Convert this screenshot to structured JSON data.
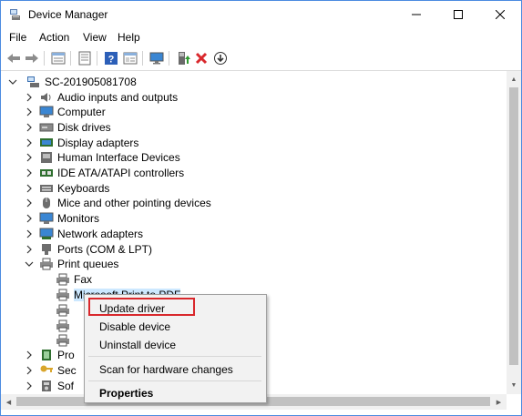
{
  "window": {
    "title": "Device Manager",
    "accent": "#4c8be0"
  },
  "menu": [
    "File",
    "Action",
    "View",
    "Help"
  ],
  "toolbar": {
    "icons": [
      "back-arrow-icon",
      "forward-arrow-icon",
      "properties-icon",
      "hide-show-tree-icon",
      "help-icon",
      "view-list-icon",
      "monitor-icon",
      "enable-device-icon",
      "uninstall-device-icon",
      "download-driver-icon"
    ],
    "accent_red": "#d9282c",
    "accent_green": "#2e9b2e"
  },
  "tree": {
    "root": "SC-201905081708",
    "categories": [
      {
        "label": "Audio inputs and outputs",
        "icon": "speaker-icon"
      },
      {
        "label": "Computer",
        "icon": "computer-icon"
      },
      {
        "label": "Disk drives",
        "icon": "disk-drive-icon"
      },
      {
        "label": "Display adapters",
        "icon": "display-adapter-icon"
      },
      {
        "label": "Human Interface Devices",
        "icon": "hid-icon"
      },
      {
        "label": "IDE ATA/ATAPI controllers",
        "icon": "ide-controller-icon"
      },
      {
        "label": "Keyboards",
        "icon": "keyboard-icon"
      },
      {
        "label": "Mice and other pointing devices",
        "icon": "mouse-icon"
      },
      {
        "label": "Monitors",
        "icon": "monitor-icon"
      },
      {
        "label": "Network adapters",
        "icon": "network-adapter-icon"
      },
      {
        "label": "Ports (COM & LPT)",
        "icon": "port-icon"
      },
      {
        "label": "Print queues",
        "icon": "printer-icon"
      }
    ],
    "print_queue_children": [
      "Fax",
      "Microsoft Print to PDF",
      "",
      "",
      ""
    ],
    "lower_categories": [
      "Pro",
      "Sec",
      "Sof",
      ""
    ]
  },
  "context_menu": {
    "items": [
      "Update driver",
      "Disable device",
      "Uninstall device",
      "Scan for hardware changes",
      "Properties"
    ],
    "highlight_color": "#d9282c"
  }
}
